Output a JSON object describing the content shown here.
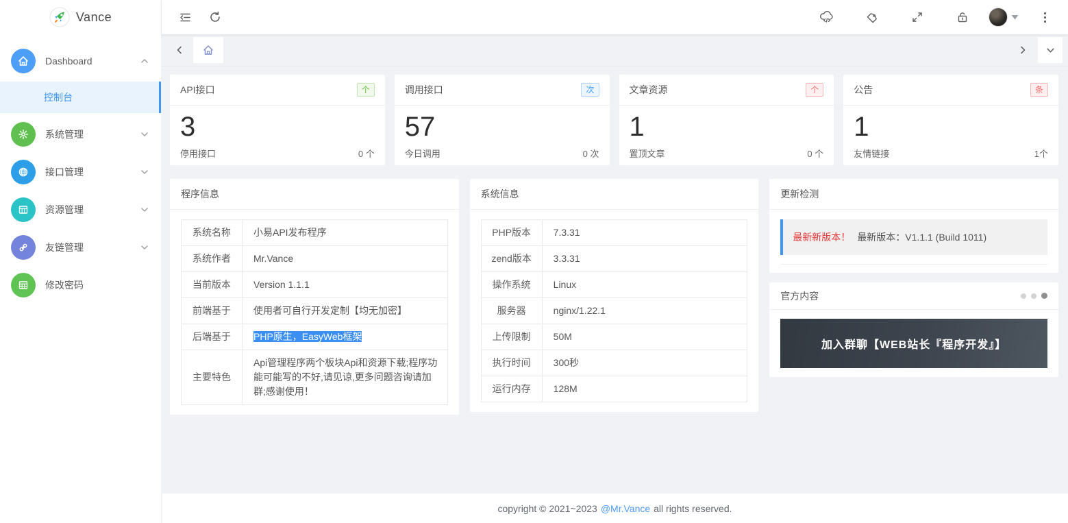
{
  "brand": {
    "name": "Vance",
    "logo_icon": "rocket-icon"
  },
  "sidebar": {
    "items": [
      {
        "label": "Dashboard",
        "icon": "home-icon",
        "color": "#4D9EF6",
        "chevron": "up"
      },
      {
        "label": "系统管理",
        "icon": "gear-icon",
        "color": "#5FBF4F",
        "chevron": "down"
      },
      {
        "label": "接口管理",
        "icon": "globe-icon",
        "color": "#2D9FE9",
        "chevron": "down"
      },
      {
        "label": "资源管理",
        "icon": "grid-icon",
        "color": "#2AC3C6",
        "chevron": "down"
      },
      {
        "label": "友链管理",
        "icon": "link-icon",
        "color": "#7484DC",
        "chevron": "down"
      },
      {
        "label": "修改密码",
        "icon": "grid-icon",
        "color": "#5FC453",
        "chevron": "none"
      }
    ],
    "submenu": {
      "label": "控制台",
      "active": true
    }
  },
  "header": {
    "icons": [
      "collapse-menu-icon",
      "refresh-icon",
      "cloud-code-icon",
      "tag-icon",
      "fullscreen-icon",
      "lock-icon",
      "avatar",
      "caret-down-icon",
      "more-vertical-icon"
    ]
  },
  "stats": [
    {
      "title": "API接口",
      "badge": {
        "text": "个",
        "type": "success"
      },
      "value": "3",
      "foot_label": "停用接口",
      "foot_value": "0 个"
    },
    {
      "title": "调用接口",
      "badge": {
        "text": "次",
        "type": "primary"
      },
      "value": "57",
      "foot_label": "今日调用",
      "foot_value": "0 次"
    },
    {
      "title": "文章资源",
      "badge": {
        "text": "个",
        "type": "danger"
      },
      "value": "1",
      "foot_label": "置顶文章",
      "foot_value": "0 个"
    },
    {
      "title": "公告",
      "badge": {
        "text": "条",
        "type": "danger"
      },
      "value": "1",
      "foot_label": "友情链接",
      "foot_value": "1个"
    }
  ],
  "program_info": {
    "title": "程序信息",
    "rows": [
      {
        "label": "系统名称",
        "value": "小易API发布程序"
      },
      {
        "label": "系统作者",
        "value": "Mr.Vance"
      },
      {
        "label": "当前版本",
        "value": "Version 1.1.1"
      },
      {
        "label": "前端基于",
        "value": "使用者可自行开发定制【均无加密】"
      },
      {
        "label": "后端基于",
        "value": "PHP原生，EasyWeb框架",
        "highlighted": true
      },
      {
        "label": "主要特色",
        "value": "Api管理程序两个板块Api和资源下载;程序功能可能写的不好,请见谅,更多问题咨询请加群;感谢使用！"
      }
    ]
  },
  "system_info": {
    "title": "系统信息",
    "rows": [
      {
        "label": "PHP版本",
        "value": "7.3.31"
      },
      {
        "label": "zend版本",
        "value": "3.3.31"
      },
      {
        "label": "操作系统",
        "value": "Linux"
      },
      {
        "label": "服务器",
        "value": "nginx/1.22.1"
      },
      {
        "label": "上传限制",
        "value": "50M"
      },
      {
        "label": "执行时间",
        "value": "300秒"
      },
      {
        "label": "运行内存",
        "value": "128M"
      }
    ]
  },
  "update_check": {
    "title": "更新检测",
    "alert_highlight": "最新新版本！",
    "alert_text": "最新版本：V1.1.1 (Build 1011)",
    "accent_color": "#3E97F2",
    "highlight_color": "#E43A3A"
  },
  "official": {
    "title": "官方内容",
    "banner_text": "加入群聊【WEB站长『程序开发』】",
    "dots_total": 3,
    "active_dot_index": 2
  },
  "footer": {
    "prefix": "copyright © 2021~2023",
    "link": "@Mr.Vance",
    "suffix": "all rights reserved."
  },
  "colors": {
    "accent": "#3E97F2",
    "content_bg": "#f0f2f5",
    "selection_bg": "#3b8ff3",
    "banner_from": "#323941",
    "banner_to": "#4e565f"
  }
}
